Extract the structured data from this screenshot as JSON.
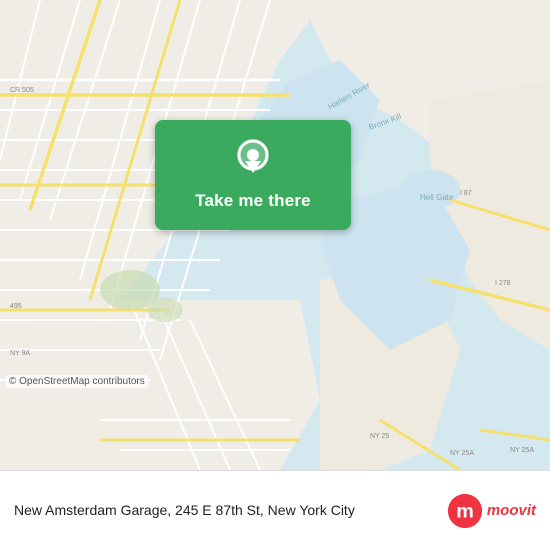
{
  "map": {
    "attribution": "© OpenStreetMap contributors"
  },
  "button": {
    "label": "Take me there",
    "bg_color": "#3aaa5f"
  },
  "bottom": {
    "address": "New Amsterdam Garage, 245 E 87th St, New York City"
  },
  "moovit": {
    "alt": "moovit"
  }
}
